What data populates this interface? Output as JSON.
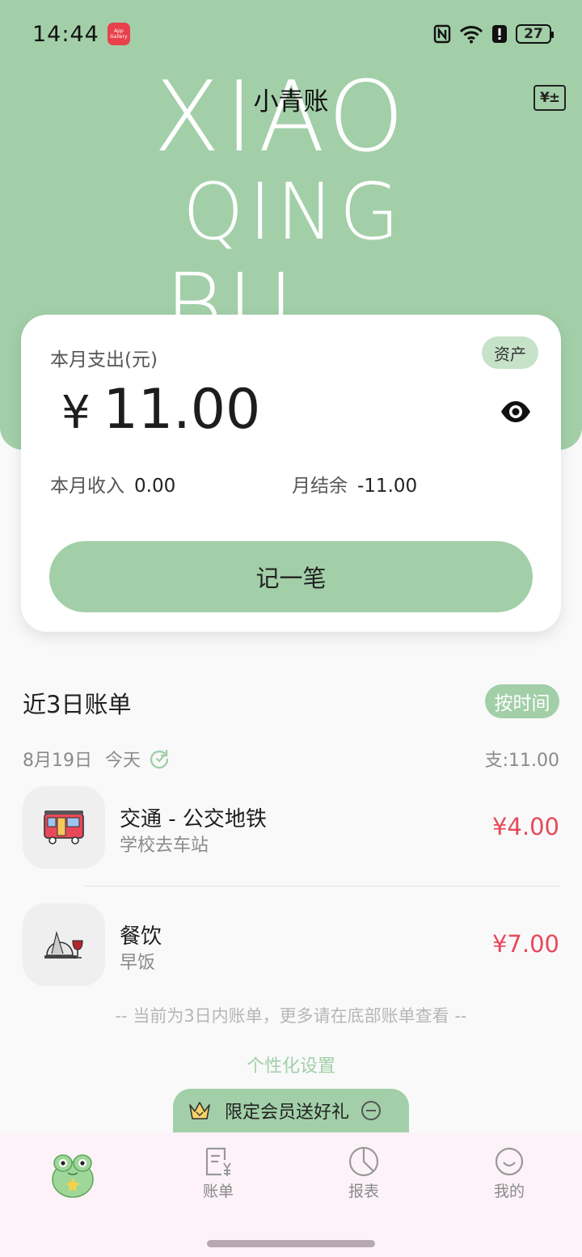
{
  "status_bar": {
    "time": "14:44",
    "battery": "27",
    "app_badge": "App Gallery"
  },
  "header": {
    "title": "小青账",
    "bg_lines": [
      "XIAO",
      "QING",
      "BU"
    ]
  },
  "summary": {
    "label": "本月支出(元)",
    "asset_button": "资产",
    "currency": "¥",
    "expense": "11.00",
    "income_label": "本月收入",
    "income": "0.00",
    "balance_label": "月结余",
    "balance": "-11.00",
    "record_button": "记一笔"
  },
  "recent": {
    "title": "近3日账单",
    "sort_button": "按时间",
    "date": "8月19日",
    "today": "今天",
    "day_total": "支:11.00",
    "bills": [
      {
        "category": "交通 - 公交地铁",
        "note": "学校去车站",
        "amount": "¥4.00"
      },
      {
        "category": "餐饮",
        "note": "早饭",
        "amount": "¥7.00"
      }
    ],
    "hint": "-- 当前为3日内账单，更多请在底部账单查看 --",
    "settings_link": "个性化设置"
  },
  "promo": {
    "text": "限定会员送好礼"
  },
  "tabbar": {
    "items": [
      {
        "label": ""
      },
      {
        "label": "账单"
      },
      {
        "label": "报表"
      },
      {
        "label": "我的"
      }
    ]
  },
  "colors": {
    "accent": "#a2cfa8",
    "expense_red": "#e8495a",
    "tabbar_bg": "#fcf2f8"
  }
}
